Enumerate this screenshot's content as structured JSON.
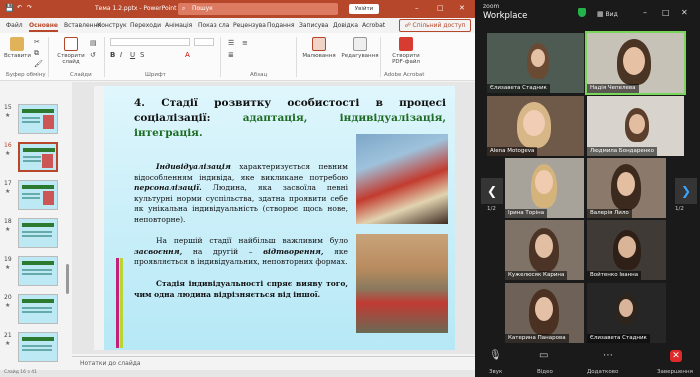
{
  "titlebar": {
    "filename": "Тема 1.2.pptx",
    "app": "PowerPoint",
    "search": "Пошук",
    "signin": "Увійти"
  },
  "tabs": [
    "Файл",
    "Основне",
    "Вставлення",
    "Конструктор",
    "Переходи",
    "Анімація",
    "Показ сла",
    "Рецензува",
    "Подання",
    "Записува",
    "Довідка",
    "Acrobat"
  ],
  "share": "Спільний доступ",
  "ribbon": {
    "paste": "Вставити",
    "clipboard": "Буфер обміну",
    "new_slide": "Створити слайд",
    "slides": "Слайди",
    "font": "Шрифт",
    "paragraph": "Абзац",
    "drawing": "Малювання",
    "editing": "Редагування",
    "create_pdf": "Створити PDF-файл",
    "acrobat": "Adobe Acrobat"
  },
  "thumbnails": [
    {
      "num": "15",
      "active": false
    },
    {
      "num": "16",
      "active": true
    },
    {
      "num": "17",
      "active": false
    },
    {
      "num": "18",
      "active": false
    },
    {
      "num": "19",
      "active": false
    },
    {
      "num": "20",
      "active": false
    },
    {
      "num": "21",
      "active": false
    }
  ],
  "slide": {
    "heading_plain": "4. Стадії розвитку особистості в процесі соціалізації: ",
    "heading_green": "адаптація, індивідуалізація, інтеграція.",
    "p1_em": "Індивідуалізація",
    "p1_a": " характеризується певним відособленням індивіда, яке викликане потребою ",
    "p1_em2": "персоналізації.",
    "p1_b": " Людина, яка засвоїла певні культурні норми суспільства, здатна проявити себе як унікальна індивідуальність (створює щось нове, неповторне).",
    "p2_a": "На першій стадії найбільш важливим було ",
    "p2_em": "засвоєння,",
    "p2_b": " на другій – ",
    "p2_em2": "відтворення,",
    "p2_c": " яке проявляється в індивідуальних, неповторних формах.",
    "p3": "Стадія індивідуальності спряє вияву того, чим одна людина відрізняється від іншої."
  },
  "notes": "Нотатки до слайда",
  "status": "Слайд 16 з 41",
  "zoom": {
    "logo": "zoom",
    "workplace": "Workplace",
    "view": "Вид",
    "page_left": "1/2",
    "page_right": "1/2",
    "participants": [
      {
        "name": "Єлизавета Стадник"
      },
      {
        "name": "Надія Чепелева"
      },
      {
        "name": "Alena Motogeva"
      },
      {
        "name": "Людмила Бондаренко"
      },
      {
        "name": "Ірина Торіна"
      },
      {
        "name": "Валерія Лило"
      },
      {
        "name": "Кужелюсяк Карина"
      },
      {
        "name": "Войтенко Іванна"
      },
      {
        "name": "Катерина Панарова"
      },
      {
        "name": "Єлизавета Стадник"
      }
    ],
    "controls": {
      "mute": "Звук",
      "video": "Відео",
      "more": "Додатково",
      "end": "Завершення"
    }
  },
  "colors": {
    "brand": "#b7472a",
    "zoom_active": "#7ad65a",
    "end": "#e02a2a"
  }
}
